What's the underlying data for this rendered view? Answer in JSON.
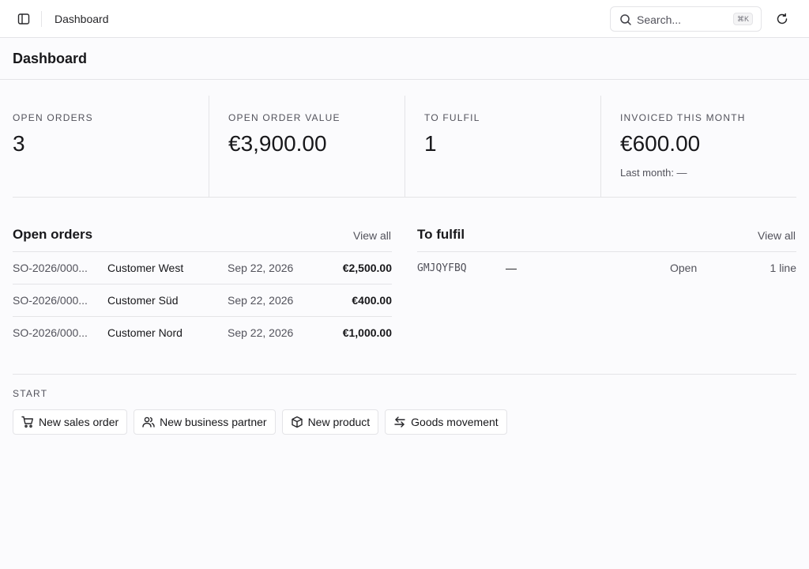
{
  "topbar": {
    "breadcrumb": "Dashboard",
    "search_placeholder": "Search...",
    "search_shortcut": "⌘K"
  },
  "page": {
    "title": "Dashboard"
  },
  "kpis": [
    {
      "label": "OPEN ORDERS",
      "value": "3"
    },
    {
      "label": "OPEN ORDER VALUE",
      "value": "€3,900.00"
    },
    {
      "label": "TO FULFIL",
      "value": "1"
    },
    {
      "label": "INVOICED THIS MONTH",
      "value": "€600.00",
      "sub": "Last month: —"
    }
  ],
  "open_orders": {
    "title": "Open orders",
    "view_all": "View all",
    "rows": [
      {
        "number": "SO-2026/000...",
        "customer": "Customer West",
        "date": "Sep 22, 2026",
        "amount": "€2,500.00"
      },
      {
        "number": "SO-2026/000...",
        "customer": "Customer Süd",
        "date": "Sep 22, 2026",
        "amount": "€400.00"
      },
      {
        "number": "SO-2026/000...",
        "customer": "Customer Nord",
        "date": "Sep 22, 2026",
        "amount": "€1,000.00"
      }
    ]
  },
  "to_fulfil": {
    "title": "To fulfil",
    "view_all": "View all",
    "rows": [
      {
        "code": "GMJQYFBQ",
        "partner": "—",
        "status": "Open",
        "lines": "1 line"
      }
    ]
  },
  "start": {
    "label": "START",
    "actions": [
      {
        "label": "New sales order",
        "icon": "cart-icon"
      },
      {
        "label": "New business partner",
        "icon": "users-icon"
      },
      {
        "label": "New product",
        "icon": "package-icon"
      },
      {
        "label": "Goods movement",
        "icon": "arrows-icon"
      }
    ]
  },
  "colors": {
    "background": "#fbfbfd",
    "border": "#e4e4e7",
    "text": "#18181b",
    "muted": "#52525b"
  }
}
